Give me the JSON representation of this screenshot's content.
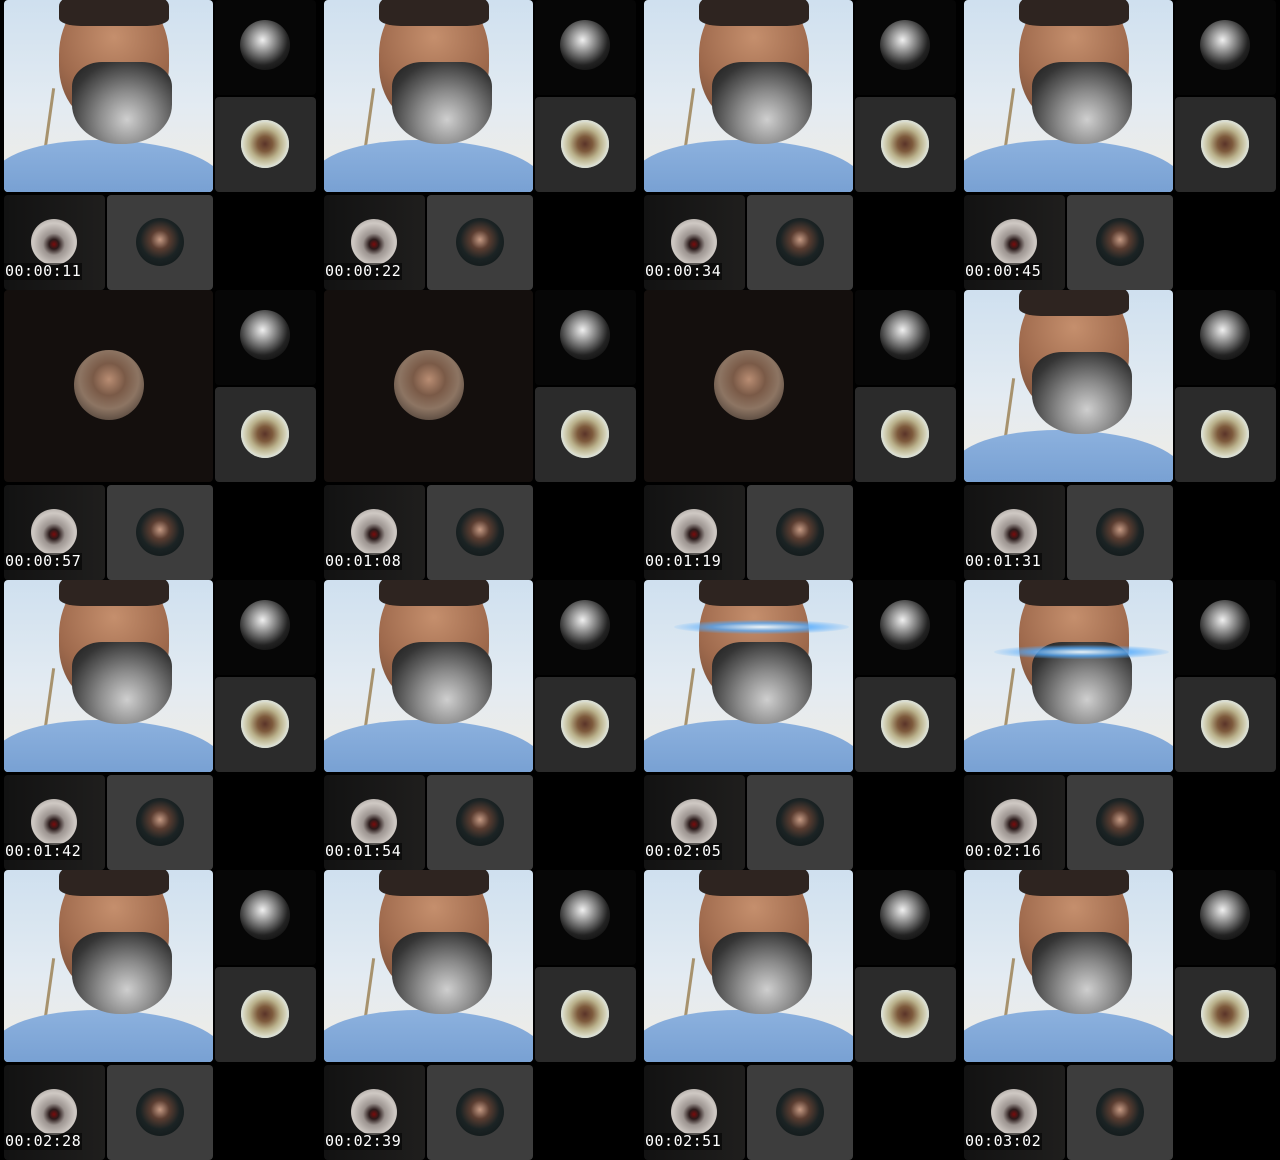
{
  "thumbnails": [
    {
      "timestamp": "00:00:11",
      "main_view": "face",
      "effect": "none"
    },
    {
      "timestamp": "00:00:22",
      "main_view": "face",
      "effect": "none"
    },
    {
      "timestamp": "00:00:34",
      "main_view": "face",
      "effect": "none"
    },
    {
      "timestamp": "00:00:45",
      "main_view": "face",
      "effect": "none"
    },
    {
      "timestamp": "00:00:57",
      "main_view": "avatar",
      "effect": "none"
    },
    {
      "timestamp": "00:01:08",
      "main_view": "avatar",
      "effect": "none"
    },
    {
      "timestamp": "00:01:19",
      "main_view": "avatar",
      "effect": "none"
    },
    {
      "timestamp": "00:01:31",
      "main_view": "face",
      "effect": "none"
    },
    {
      "timestamp": "00:01:42",
      "main_view": "face",
      "effect": "none"
    },
    {
      "timestamp": "00:01:54",
      "main_view": "face",
      "effect": "none"
    },
    {
      "timestamp": "00:02:05",
      "main_view": "face",
      "effect": "glow-eyes"
    },
    {
      "timestamp": "00:02:16",
      "main_view": "face",
      "effect": "glow-mouth"
    },
    {
      "timestamp": "00:02:28",
      "main_view": "face",
      "effect": "none"
    },
    {
      "timestamp": "00:02:39",
      "main_view": "face",
      "effect": "none"
    },
    {
      "timestamp": "00:02:51",
      "main_view": "face",
      "effect": "none"
    },
    {
      "timestamp": "00:03:02",
      "main_view": "face",
      "effect": "none"
    }
  ],
  "colors": {
    "background": "#000000",
    "tile_dark": "#2b2b2b",
    "tile_gray": "#3d3d3d",
    "timestamp_text": "#ffffff",
    "glow": "#3ea0ff"
  }
}
